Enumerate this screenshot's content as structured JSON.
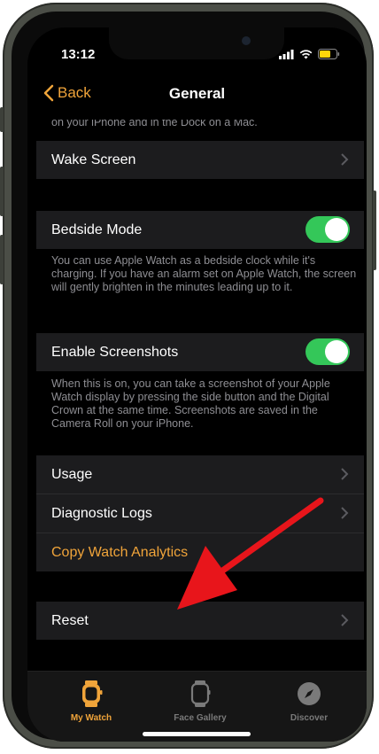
{
  "status_bar": {
    "time": "13:12"
  },
  "nav": {
    "back_label": "Back",
    "title": "General"
  },
  "clipped_text": "on your iPhone and in the Dock on a Mac.",
  "wake_screen": {
    "label": "Wake Screen"
  },
  "bedside_mode": {
    "label": "Bedside Mode",
    "enabled": true,
    "description": "You can use Apple Watch as a bedside clock while it's charging. If you have an alarm set on Apple Watch, the screen will gently brighten in the minutes leading up to it."
  },
  "enable_screenshots": {
    "label": "Enable Screenshots",
    "enabled": true,
    "description": "When this is on, you can take a screenshot of your Apple Watch display by pressing the side button and the Digital Crown at the same time. Screenshots are saved in the Camera Roll on your iPhone."
  },
  "group_items": [
    {
      "label": "Usage"
    },
    {
      "label": "Diagnostic Logs"
    },
    {
      "label": "Copy Watch Analytics"
    }
  ],
  "reset": {
    "label": "Reset"
  },
  "tabbar": {
    "tabs": [
      {
        "label": "My Watch",
        "icon": "watch-icon",
        "active": true
      },
      {
        "label": "Face Gallery",
        "icon": "watch-face-icon",
        "active": false
      },
      {
        "label": "Discover",
        "icon": "compass-icon",
        "active": false
      }
    ]
  },
  "colors": {
    "accent": "#f0a43a",
    "toggle_on": "#34c759",
    "cell_bg": "#1c1c1e",
    "annotation_arrow": "#e8151b"
  }
}
